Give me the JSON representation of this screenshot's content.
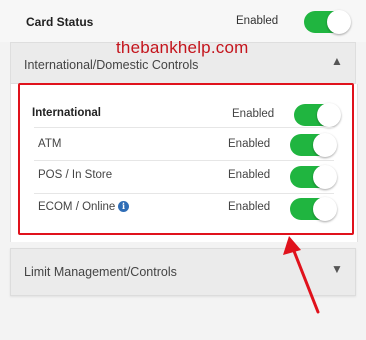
{
  "card_status": {
    "label": "Card Status",
    "value": "Enabled"
  },
  "watermark": "thebankhelp.com",
  "intl_section": {
    "title": "International/Domestic Controls",
    "rows": [
      {
        "label": "International",
        "value": "Enabled"
      },
      {
        "label": "ATM",
        "value": "Enabled"
      },
      {
        "label": "POS / In Store",
        "value": "Enabled"
      },
      {
        "label": "ECOM / Online",
        "value": "Enabled"
      }
    ]
  },
  "limit_section": {
    "title": "Limit Management/Controls"
  },
  "colors": {
    "toggle_on": "#20b540",
    "highlight": "#e0121c",
    "info_icon": "#2f6db6"
  }
}
